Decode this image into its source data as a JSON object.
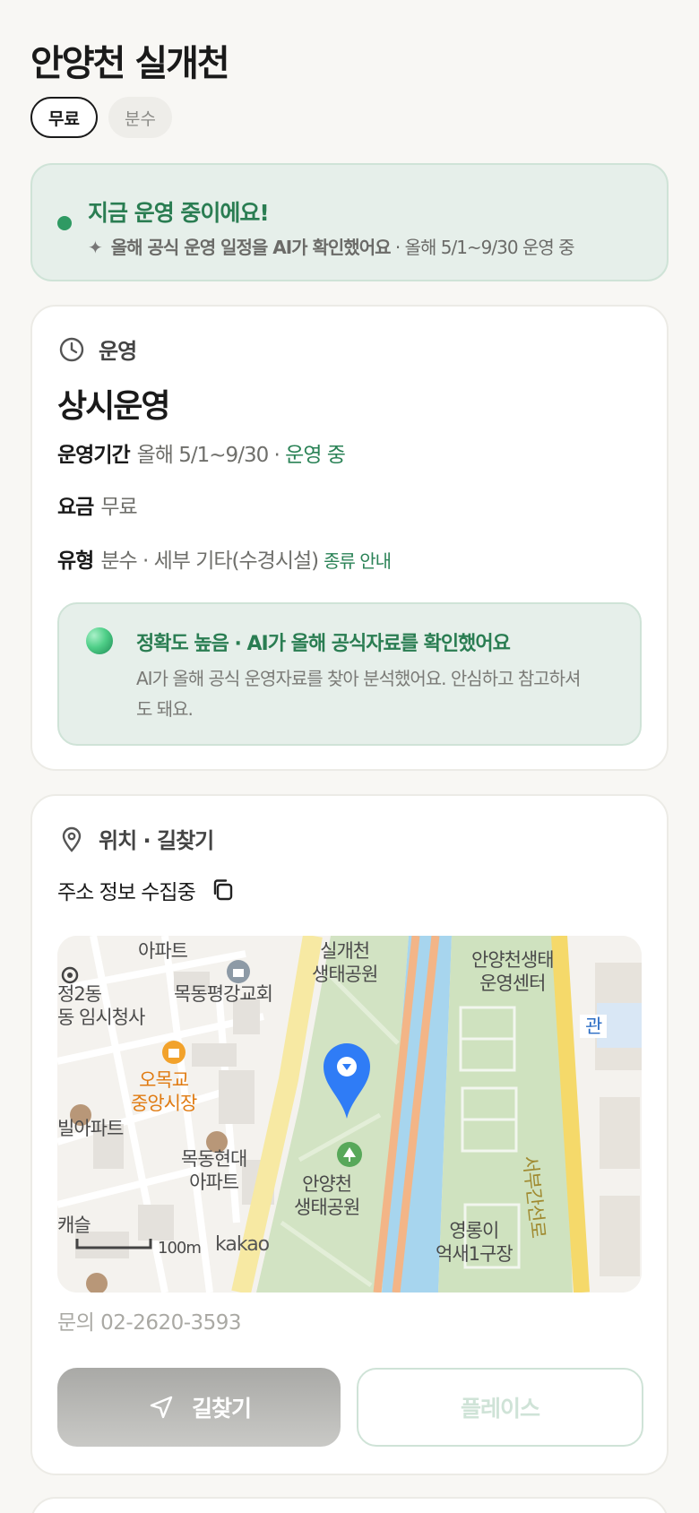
{
  "page_title": "안양천 실개천",
  "tags": [
    "무료",
    "분수"
  ],
  "status": {
    "title": "지금 운영 중이에요!",
    "sub_bold": "올해 공식 운영 일정을 AI가 확인했어요",
    "sub_rest": " · 올해 5/1~9/30 운영 중",
    "color": "#2a7d52"
  },
  "hours": {
    "section_label": "운영",
    "main": "상시운영",
    "period_label": "운영기간",
    "period_value": "올해 5/1~9/30 · ",
    "period_status": "운영 중",
    "fee_label": "요금",
    "fee_value": "무료",
    "type_label": "유형",
    "type_value": "분수 · 세부 기타(수경시설)",
    "type_link": "종류 안내",
    "ai_title": "정확도 높음 · AI가 올해 공식자료를 확인했어요",
    "ai_desc": "AI가 올해 공식 운영자료를 찾아 분석했어요. 안심하고 참고하셔도 돼요."
  },
  "location": {
    "section_label": "위치 · 길찾기",
    "address": "주소 정보 수집중",
    "phone": "문의 02-2620-3593",
    "route_button": "길찾기",
    "place_button": "플레이스",
    "map_labels": {
      "apt_top": "아파트",
      "silgae": "실개천\n생태공원",
      "center": "안양천생태\n운영센터",
      "dong": "정2동\n동 임시청사",
      "church": "목동평강교회",
      "kwan": "관",
      "market": "오목교\n중앙시장",
      "villa": "빌아파트",
      "hyundai": "목동현대\n아파트",
      "ecopark": "안양천\n생태공원",
      "road": "서부간선로",
      "field": "영롱이\n억새1구장",
      "kaeseul": "캐슬",
      "scale": "100m",
      "brand": "kakao"
    }
  }
}
